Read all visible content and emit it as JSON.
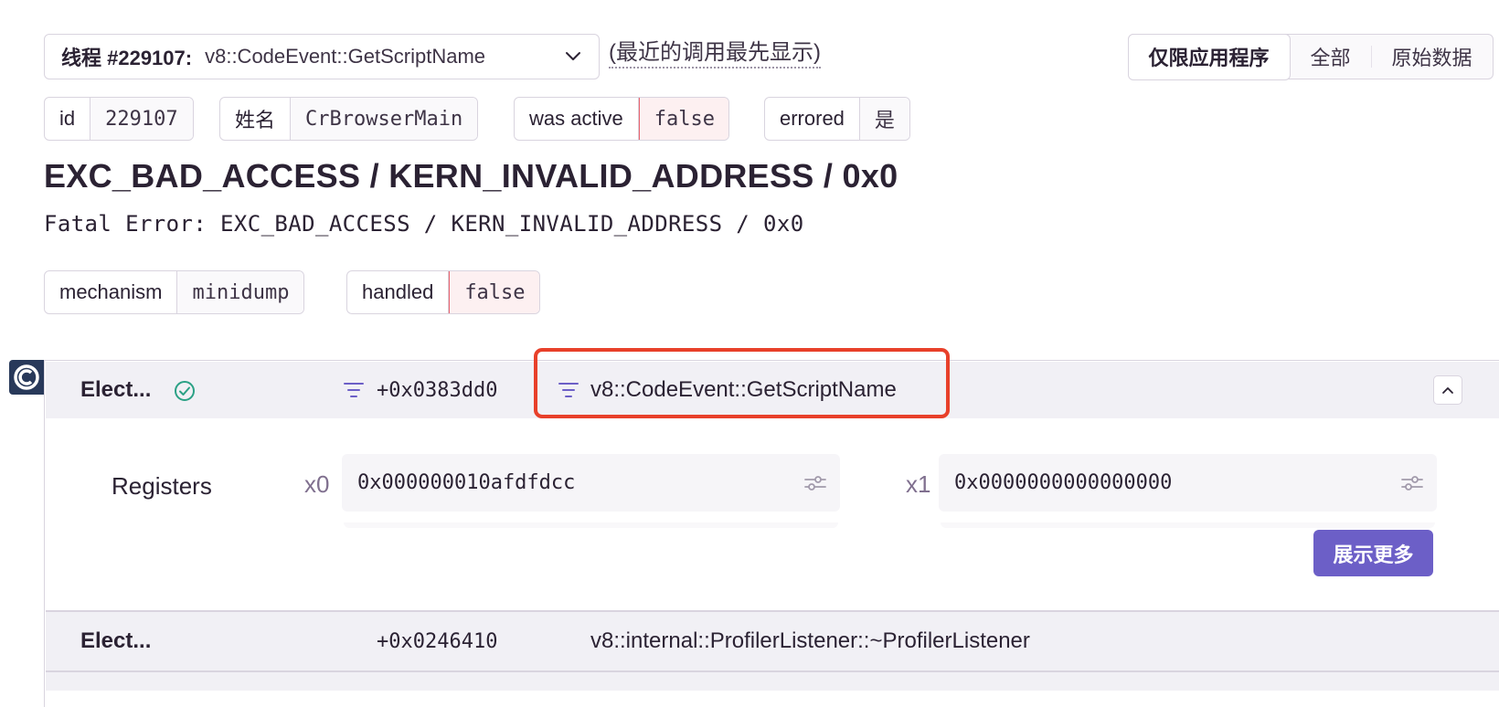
{
  "thread": {
    "label": "线程 #229107:",
    "value": "v8::CodeEvent::GetScriptName",
    "order_note": "(最近的调用最先显示)"
  },
  "view_toggle": {
    "options": [
      "仅限应用程序",
      "全部",
      "原始数据"
    ],
    "active": "仅限应用程序"
  },
  "thread_tags": [
    {
      "key": "id",
      "value": "229107"
    },
    {
      "key": "姓名",
      "value": "CrBrowserMain"
    },
    {
      "key": "was active",
      "value": "false"
    },
    {
      "key": "errored",
      "value": "是"
    }
  ],
  "exception": {
    "title": "EXC_BAD_ACCESS / KERN_INVALID_ADDRESS / 0x0",
    "subtitle": "Fatal Error: EXC_BAD_ACCESS / KERN_INVALID_ADDRESS / 0x0"
  },
  "mechanism_tags": [
    {
      "key": "mechanism",
      "value": "minidump"
    },
    {
      "key": "handled",
      "value": "false"
    }
  ],
  "frames": [
    {
      "package": "Elect...",
      "address": "+0x0383dd0",
      "function": "v8::CodeEvent::GetScriptName",
      "expanded": true,
      "in_app": true
    },
    {
      "package": "Elect...",
      "address": "+0x0246410",
      "function": "v8::internal::ProfilerListener::~ProfilerListener",
      "expanded": false,
      "in_app": false
    }
  ],
  "registers": {
    "label": "Registers",
    "items": [
      {
        "name": "x0",
        "value": "0x000000010afdfdcc"
      },
      {
        "name": "x1",
        "value": "0x0000000000000000"
      }
    ],
    "show_more": "展示更多"
  },
  "colors": {
    "accent": "#6c5fc7",
    "highlight": "#e8402a",
    "error": "#e8636f",
    "success": "#2ba185"
  }
}
